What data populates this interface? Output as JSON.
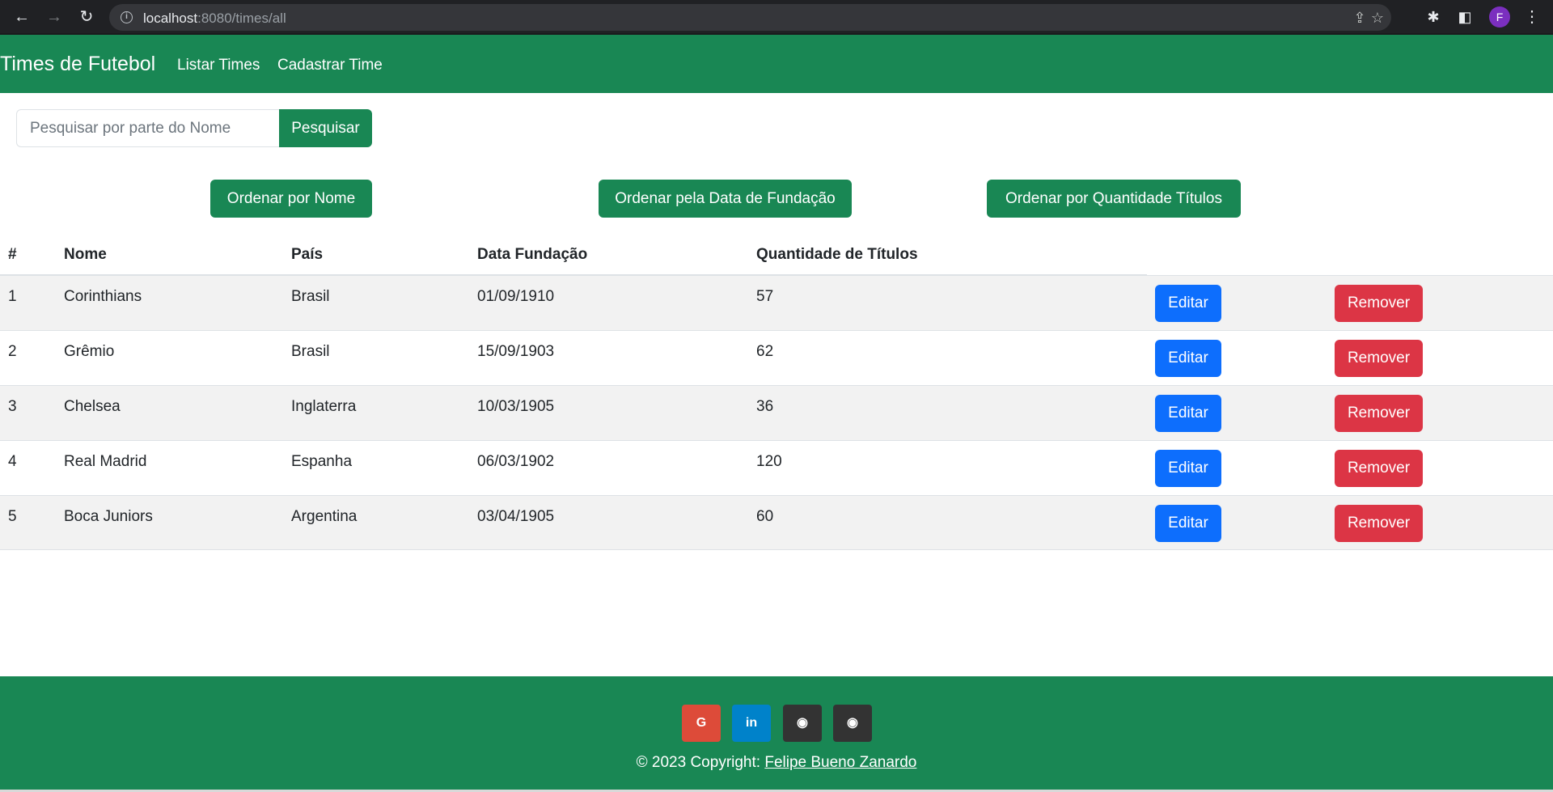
{
  "browser": {
    "url_host": "localhost",
    "url_path": ":8080/times/all",
    "profile_initial": "F"
  },
  "navbar": {
    "brand": "Times de Futebol",
    "links": [
      "Listar Times",
      "Cadastrar Time"
    ]
  },
  "search": {
    "placeholder": "Pesquisar por parte do Nome",
    "value": "",
    "button_label": "Pesquisar"
  },
  "sort_buttons": [
    "Ordenar por Nome",
    "Ordenar pela Data de Fundação",
    "Ordenar por Quantidade Títulos"
  ],
  "table": {
    "headers": [
      "#",
      "Nome",
      "País",
      "Data Fundação",
      "Quantidade de Títulos"
    ],
    "rows": [
      {
        "id": "1",
        "nome": "Corinthians",
        "pais": "Brasil",
        "data": "01/09/1910",
        "titulos": "57"
      },
      {
        "id": "2",
        "nome": "Grêmio",
        "pais": "Brasil",
        "data": "15/09/1903",
        "titulos": "62"
      },
      {
        "id": "3",
        "nome": "Chelsea",
        "pais": "Inglaterra",
        "data": "10/03/1905",
        "titulos": "36"
      },
      {
        "id": "4",
        "nome": "Real Madrid",
        "pais": "Espanha",
        "data": "06/03/1902",
        "titulos": "120"
      },
      {
        "id": "5",
        "nome": "Boca Juniors",
        "pais": "Argentina",
        "data": "03/04/1905",
        "titulos": "60"
      }
    ],
    "edit_label": "Editar",
    "remove_label": "Remover"
  },
  "footer": {
    "social": [
      {
        "icon": "google-icon",
        "glyph": "G",
        "color": "#dd4b39"
      },
      {
        "icon": "linkedin-icon",
        "glyph": "in",
        "color": "#0082ca"
      },
      {
        "icon": "github-icon",
        "glyph": "◉",
        "color": "#333333"
      },
      {
        "icon": "github-icon",
        "glyph": "◉",
        "color": "#333333"
      }
    ],
    "copyright_prefix": "© 2023 Copyright: ",
    "author": "Felipe Bueno Zanardo"
  },
  "colors": {
    "success": "#198754",
    "primary": "#0d6efd",
    "danger": "#dc3545"
  }
}
